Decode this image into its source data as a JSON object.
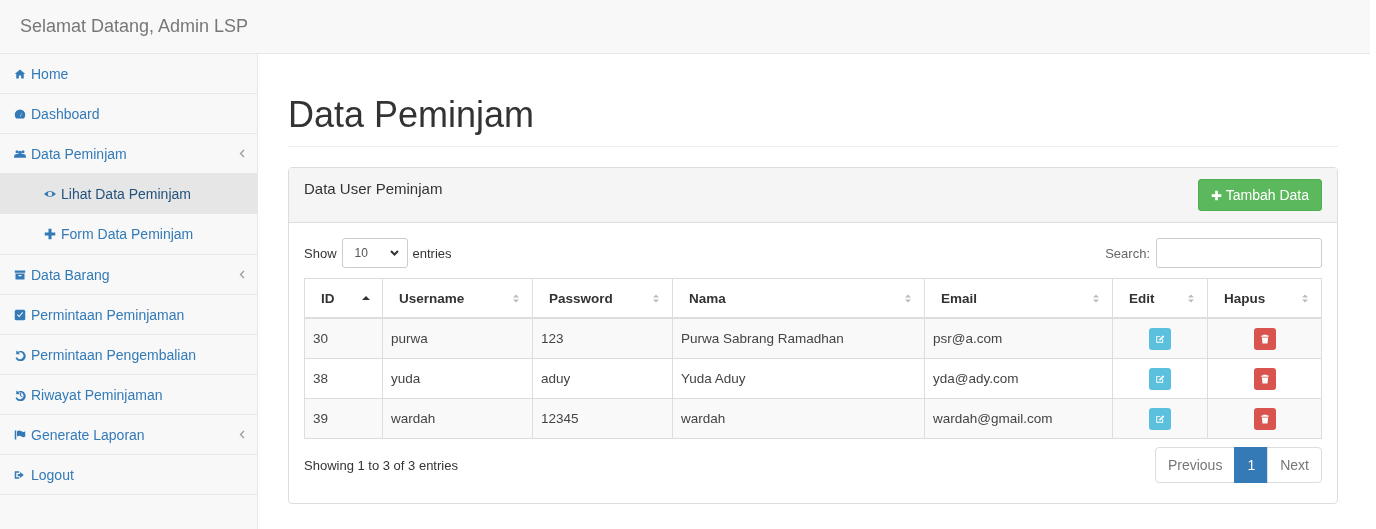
{
  "navbar": {
    "brand": "Selamat Datang, Admin LSP"
  },
  "sidebar": {
    "items": [
      {
        "label": "Home",
        "collapsible": false,
        "selected": false
      },
      {
        "label": "Dashboard",
        "collapsible": false,
        "selected": false
      },
      {
        "label": "Data Peminjam",
        "collapsible": true,
        "selected": false,
        "children": [
          {
            "label": "Lihat Data Peminjam",
            "collapsible": false,
            "selected": true
          },
          {
            "label": "Form Data Peminjam",
            "collapsible": false,
            "selected": false
          }
        ]
      },
      {
        "label": "Data Barang",
        "collapsible": true,
        "selected": false
      },
      {
        "label": "Permintaan Peminjaman",
        "collapsible": false,
        "selected": false
      },
      {
        "label": "Permintaan Pengembalian",
        "collapsible": false,
        "selected": false
      },
      {
        "label": "Riwayat Peminjaman",
        "collapsible": false,
        "selected": false
      },
      {
        "label": "Generate Laporan",
        "collapsible": true,
        "selected": false
      },
      {
        "label": "Logout",
        "collapsible": false,
        "selected": false
      }
    ]
  },
  "page_title": "Data Peminjam",
  "panel": {
    "title": "Data User Peminjam",
    "add_button": "Tambah Data",
    "length": {
      "before": "Show",
      "value": "10",
      "after": "entries"
    },
    "search": {
      "label": "Search:"
    },
    "table": {
      "columns": [
        {
          "label": "ID",
          "sorted": true
        },
        {
          "label": "Username",
          "sorted": false
        },
        {
          "label": "Password",
          "sorted": false
        },
        {
          "label": "Nama",
          "sorted": false
        },
        {
          "label": "Email",
          "sorted": false
        },
        {
          "label": "Edit",
          "sorted": false
        },
        {
          "label": "Hapus",
          "sorted": false
        }
      ],
      "rows": [
        {
          "cells": [
            "30",
            "purwa",
            "123",
            "Purwa Sabrang Ramadhan",
            "psr@a.com"
          ]
        },
        {
          "cells": [
            "38",
            "yuda",
            "aduy",
            "Yuda Aduy",
            "yda@ady.com"
          ]
        },
        {
          "cells": [
            "39",
            "wardah",
            "12345",
            "wardah",
            "wardah@gmail.com"
          ]
        }
      ]
    },
    "info": "Showing 1 to 3 of 3 entries",
    "pagination": [
      {
        "label": "Previous",
        "selected": false,
        "disabled": true
      },
      {
        "label": "1",
        "selected": true,
        "disabled": false
      },
      {
        "label": "Next",
        "selected": false,
        "disabled": true
      }
    ]
  }
}
